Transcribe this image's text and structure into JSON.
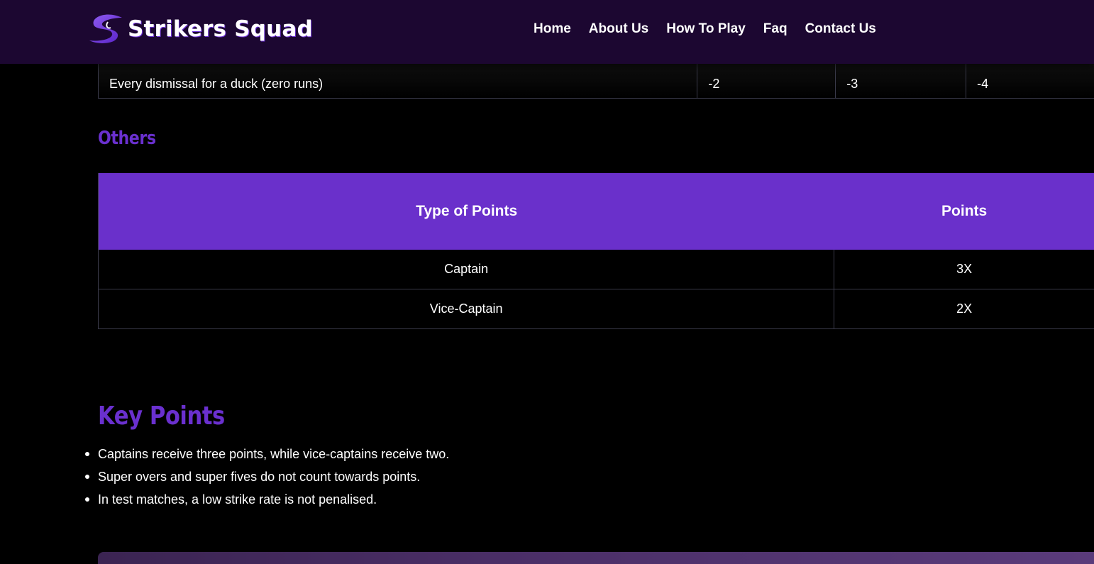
{
  "header": {
    "logo_text": "Strikers Squad",
    "nav": [
      "Home",
      "About Us",
      "How To Play",
      "Faq",
      "Contact Us"
    ]
  },
  "previous_table": {
    "row": [
      "Every dismissal for a duck (zero runs)",
      "-2",
      "-3",
      "-4"
    ]
  },
  "others": {
    "heading": "Others",
    "columns": [
      "Type of Points",
      "Points"
    ],
    "rows": [
      [
        "Captain",
        "3X"
      ],
      [
        "Vice-Captain",
        "2X"
      ]
    ]
  },
  "key_points": {
    "heading": "Key Points",
    "items": [
      "Captains receive three points, while vice-captains receive two.",
      "Super overs and super fives do not count towards points.",
      "In test matches, a low strike rate is not penalised."
    ]
  },
  "colors": {
    "header_bg": "#1c0731",
    "accent": "#6a30cb",
    "page_bg": "#000000"
  }
}
